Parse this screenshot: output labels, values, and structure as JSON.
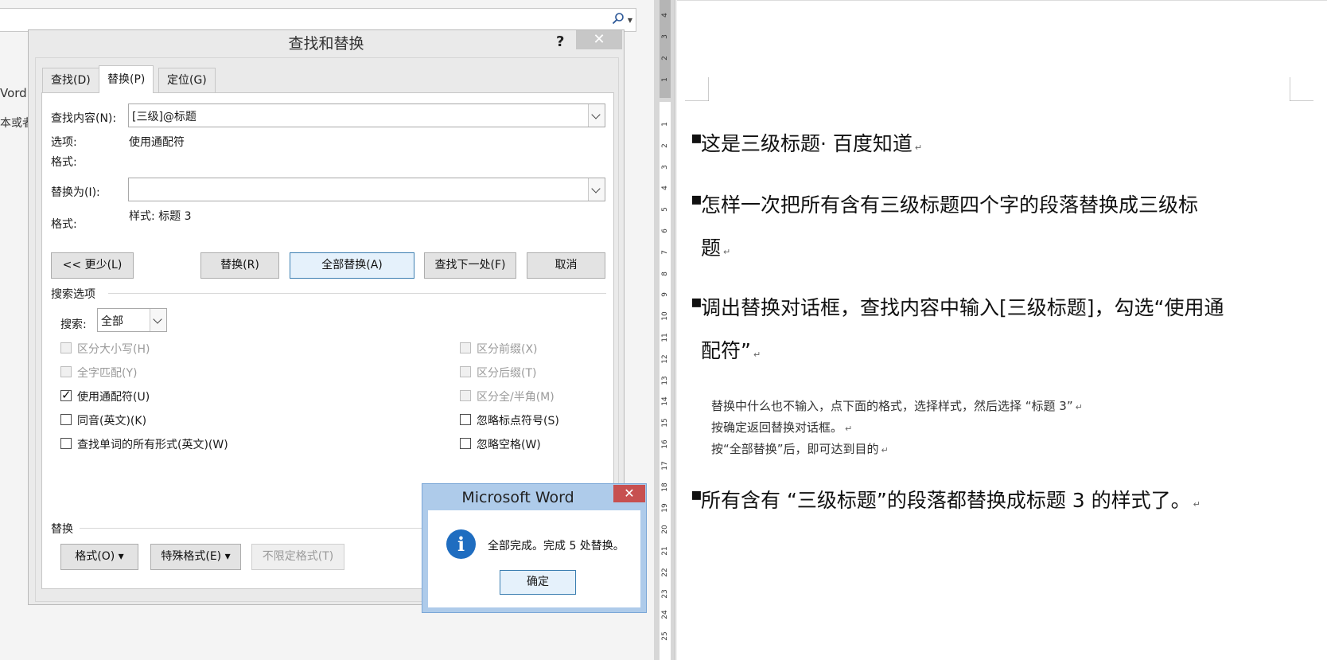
{
  "dialog": {
    "title": "查找和替换",
    "help": "?",
    "close": "✕",
    "tabs": [
      {
        "label": "查找(D)",
        "active": false
      },
      {
        "label": "替换(P)",
        "active": true
      },
      {
        "label": "定位(G)",
        "active": false
      }
    ],
    "find": {
      "label": "查找内容(N):",
      "value": "[三级]@标题",
      "options_label": "选项:",
      "options_value": "使用通配符",
      "format_label": "格式:"
    },
    "replace": {
      "label": "替换为(I):",
      "value": "",
      "style_value": "样式: 标题 3",
      "format_label": "格式:"
    },
    "buttons": {
      "less": "<< 更少(L)",
      "replace": "替换(R)",
      "replace_all": "全部替换(A)",
      "find_next": "查找下一处(F)",
      "cancel": "取消"
    },
    "search_options": {
      "heading": "搜索选项",
      "search_label": "搜索:",
      "search_value": "全部",
      "left_options": [
        {
          "label": "区分大小写(H)",
          "checked": false,
          "disabled": true
        },
        {
          "label": "全字匹配(Y)",
          "checked": false,
          "disabled": true
        },
        {
          "label": "使用通配符(U)",
          "checked": true,
          "disabled": false
        },
        {
          "label": "同音(英文)(K)",
          "checked": false,
          "disabled": false
        },
        {
          "label": "查找单词的所有形式(英文)(W)",
          "checked": false,
          "disabled": false
        }
      ],
      "right_options": [
        {
          "label": "区分前缀(X)",
          "checked": false,
          "disabled": true
        },
        {
          "label": "区分后缀(T)",
          "checked": false,
          "disabled": true
        },
        {
          "label": "区分全/半角(M)",
          "checked": false,
          "disabled": true
        },
        {
          "label": "忽略标点符号(S)",
          "checked": false,
          "disabled": false
        },
        {
          "label": "忽略空格(W)",
          "checked": false,
          "disabled": false
        }
      ]
    },
    "replace_section": {
      "heading": "替换",
      "format_button": "格式(O) ▾",
      "special_button": "特殊格式(E) ▾",
      "no_format_button": "不限定格式(T)"
    }
  },
  "message_box": {
    "title": "Microsoft Word",
    "close": "✕",
    "icon": "info-icon",
    "text": "全部完成。完成 5 处替换。",
    "ok": "确定"
  },
  "background": {
    "side_text_1": "Vord",
    "side_text_2": "本或者"
  },
  "ruler": {
    "top_numbers": [
      "4",
      "3",
      "2",
      "1"
    ],
    "numbers": [
      "1",
      "2",
      "3",
      "4",
      "5",
      "6",
      "7",
      "8",
      "9",
      "10",
      "11",
      "12",
      "13",
      "14",
      "15",
      "16",
      "17",
      "18",
      "19",
      "20",
      "21",
      "22",
      "23",
      "24",
      "25"
    ]
  },
  "document": {
    "headings": [
      "这是三级标题· 百度知道",
      "怎样一次把所有含有三级标题四个字的段落替换成三级标",
      "题",
      "调出替换对话框，查找内容中输入[三级标题]，勾选“使用通",
      "配符”",
      "所有含有 “三级标题”的段落都替换成标题 3 的样式了。"
    ],
    "paragraphs": [
      "替换中什么也不输入，点下面的格式，选择样式，然后选择 “标题 3”",
      "按确定返回替换对话框。",
      "按“全部替换”后，即可达到目的"
    ],
    "para_mark": "↵"
  }
}
